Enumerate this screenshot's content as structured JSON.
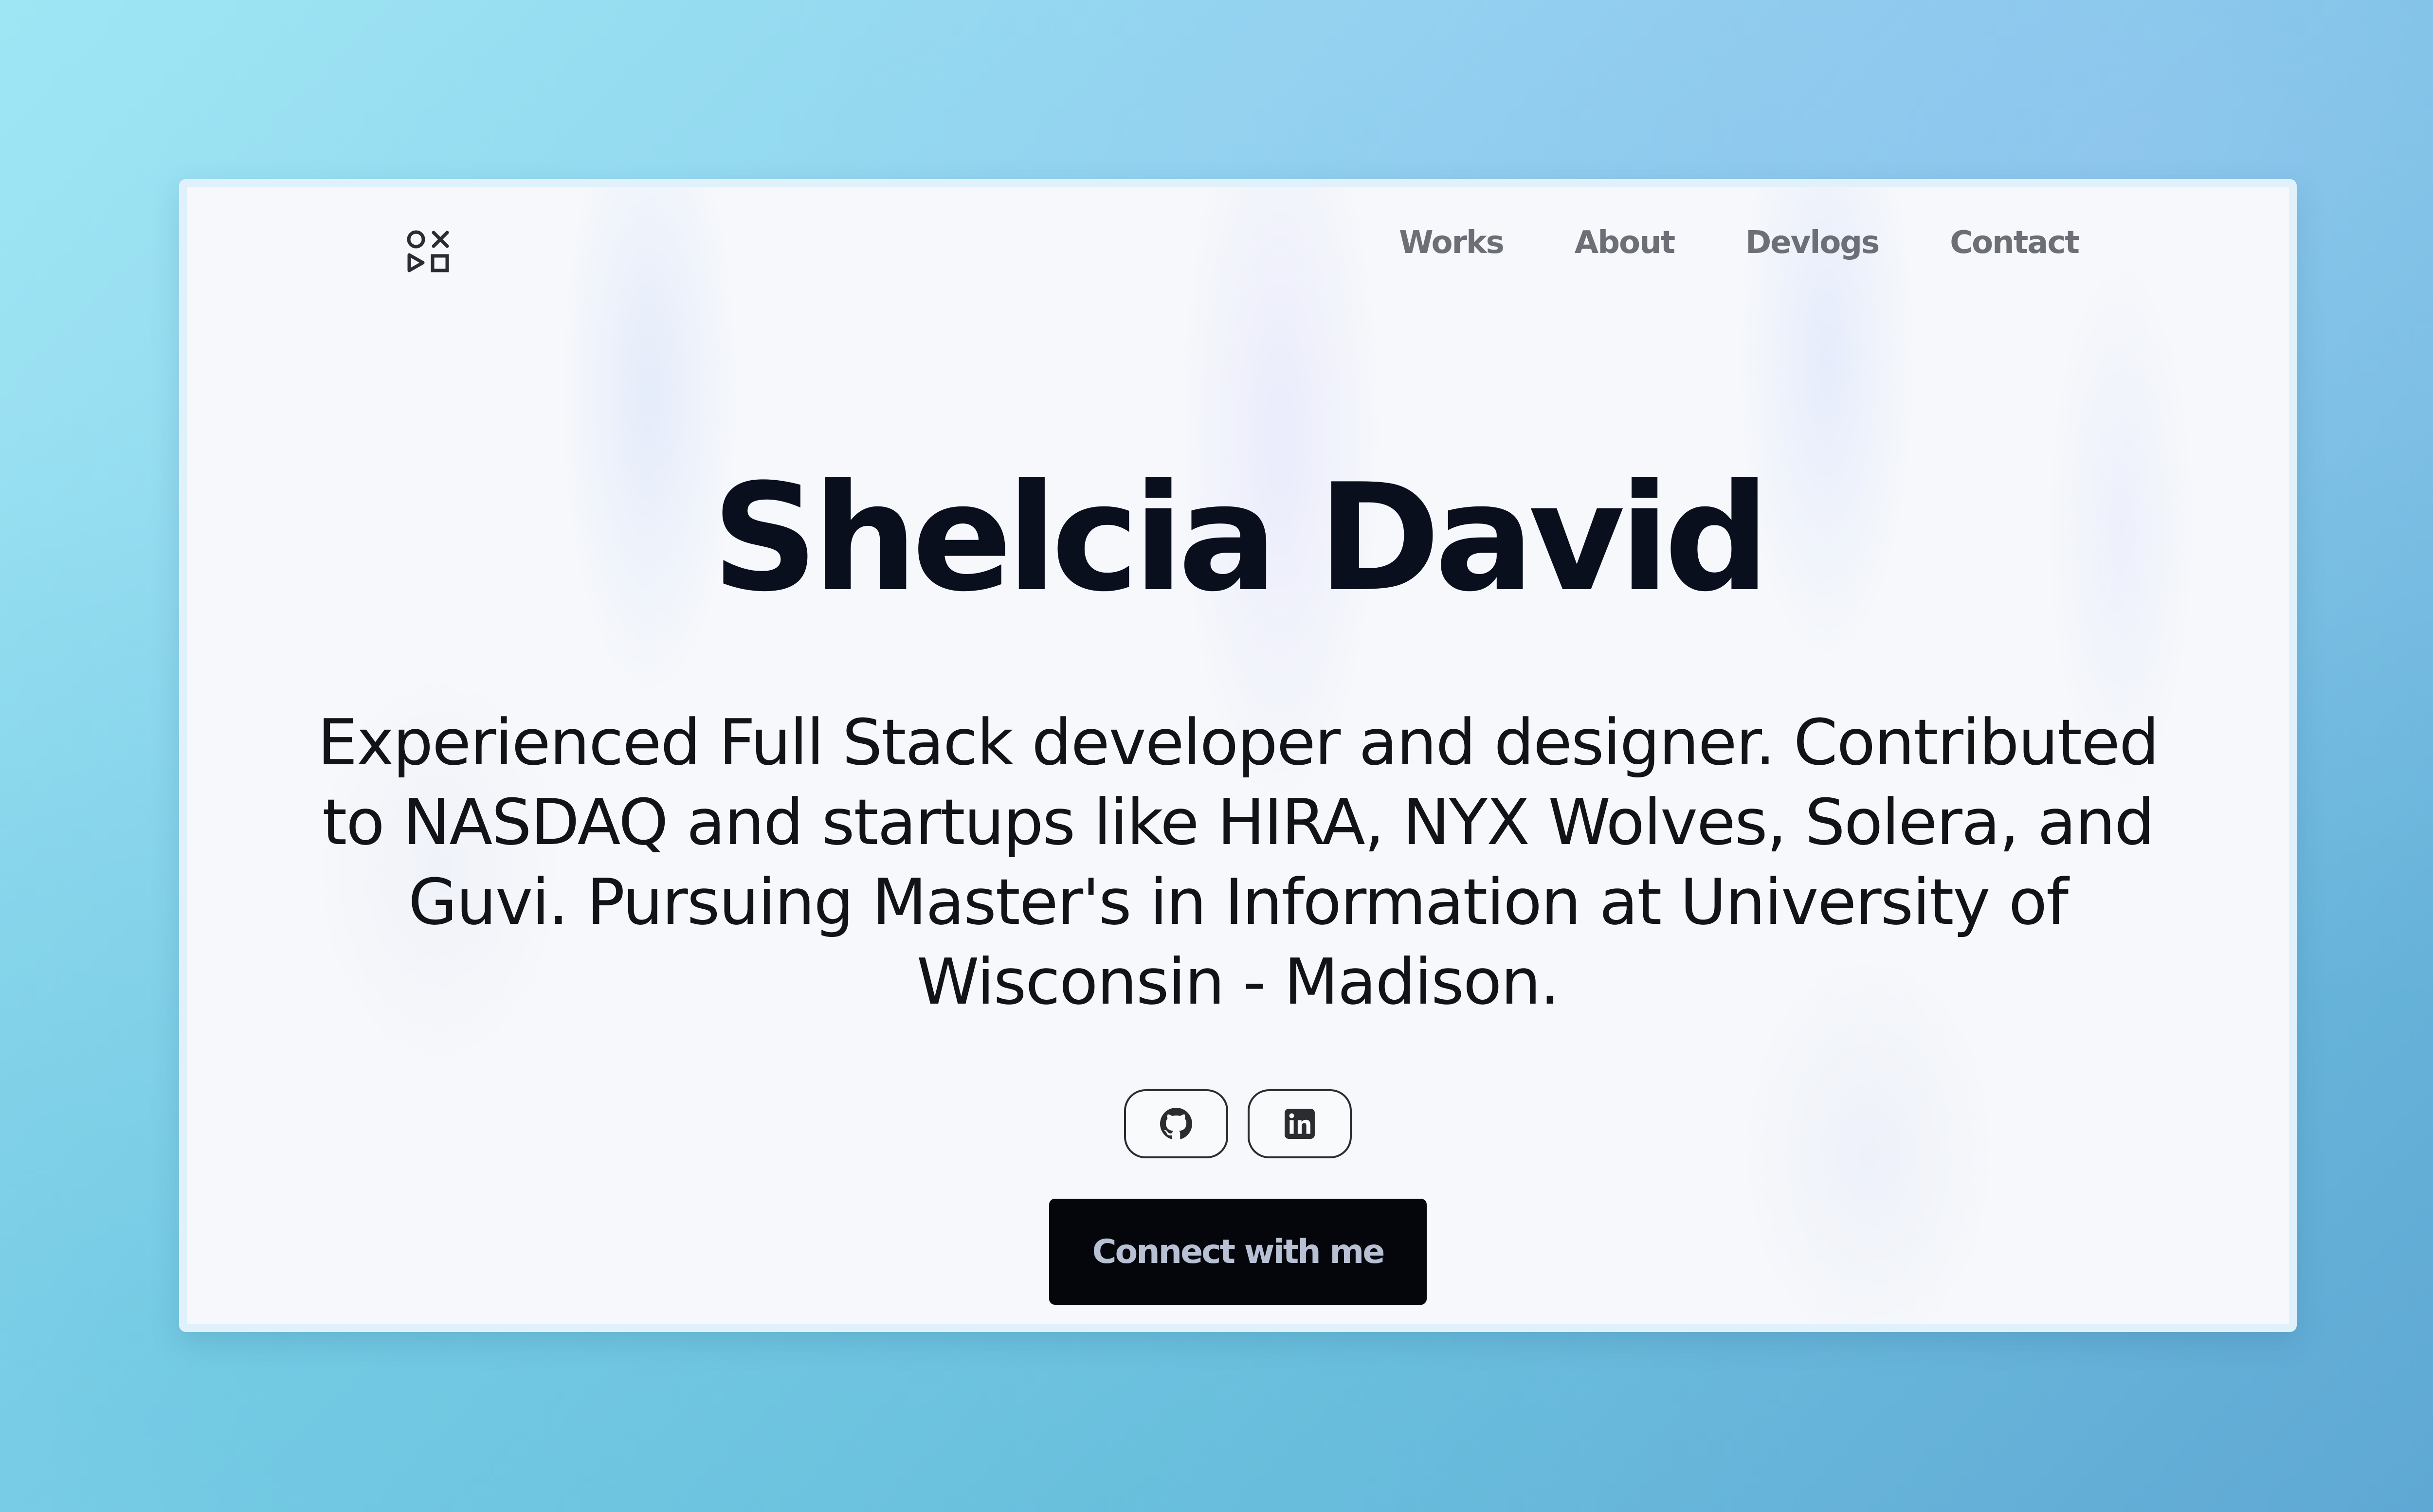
{
  "header": {
    "logo_icon": "playstation-shapes-icon",
    "nav": [
      {
        "label": "Works"
      },
      {
        "label": "About"
      },
      {
        "label": "Devlogs"
      },
      {
        "label": "Contact"
      }
    ]
  },
  "hero": {
    "name": "Shelcia David",
    "description": "Experienced Full Stack developer and designer. Contributed to NASDAQ and startups like HIRA, NYX Wolves, Solera, and Guvi. Pursuing Master's in Information at University of Wisconsin - Madison."
  },
  "socials": [
    {
      "icon": "github-icon"
    },
    {
      "icon": "linkedin-icon"
    }
  ],
  "cta": {
    "label": "Connect with me"
  },
  "colors": {
    "title": "#0a0f1e",
    "nav_text": "#6d6f76",
    "cta_bg": "#05060b",
    "cta_text": "#b8c0d4",
    "card_bg": "#f6f8fb"
  }
}
